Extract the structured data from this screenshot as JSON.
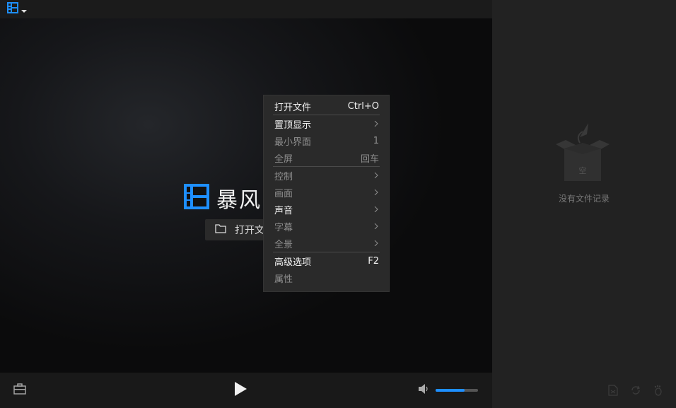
{
  "menu": {
    "items": [
      {
        "label": "打开文件",
        "shortcut": "Ctrl+O"
      },
      {
        "label": "置顶显示"
      },
      {
        "label": "最小界面",
        "shortcut": "1"
      },
      {
        "label": "全屏",
        "shortcut": "回车"
      },
      {
        "label": "控制"
      },
      {
        "label": "画面"
      },
      {
        "label": "声音"
      },
      {
        "label": "字幕"
      },
      {
        "label": "全景"
      },
      {
        "label": "高级选项",
        "shortcut": "F2"
      },
      {
        "label": "属性"
      }
    ]
  },
  "brand": {
    "text": "暴风"
  },
  "open_button": {
    "label": "打开文"
  },
  "playlist": {
    "empty_text": "没有文件记录",
    "empty_box_char": "空"
  },
  "volume": {
    "level": 0.68
  },
  "colors": {
    "accent": "#1e8fff",
    "background": "#111111",
    "panel": "#222222",
    "menu": "#2a2a2a"
  },
  "icons": {
    "logo": "film-logo-icon",
    "dropdown": "caret-down-icon",
    "minimize": "minimize-icon",
    "maximize": "maximize-icon",
    "close": "close-icon",
    "folder": "folder-icon",
    "toolbox": "toolbox-icon",
    "play": "play-icon",
    "volume": "speaker-icon",
    "playlist_file": "file-icon",
    "loop": "loop-icon",
    "footprint": "footprint-icon"
  }
}
